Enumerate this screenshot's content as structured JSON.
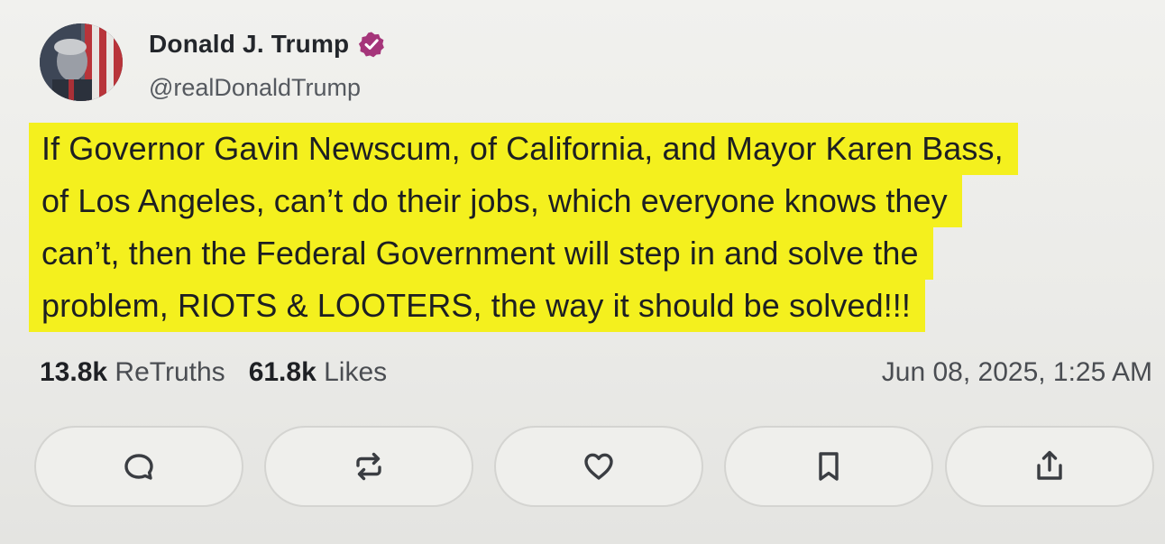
{
  "author": {
    "display_name": "Donald J. Trump",
    "handle": "@realDonaldTrump",
    "verified_icon": "verified-badge-icon",
    "verified_color": "#a5357a"
  },
  "post": {
    "lines": [
      "If Governor Gavin Newscum, of California, and Mayor Karen Bass,",
      "of Los Angeles, can’t do their jobs, which everyone knows they",
      "can’t, then the Federal Government will step in and solve the",
      "problem, RIOTS & LOOTERS, the way it should be solved!!!"
    ],
    "highlight_color": "#f4f01e"
  },
  "stats": {
    "retruths_count": "13.8k",
    "retruths_label": "ReTruths",
    "likes_count": "61.8k",
    "likes_label": "Likes"
  },
  "timestamp": "Jun 08, 2025, 1:25 AM",
  "actions": [
    {
      "icon": "reply-icon"
    },
    {
      "icon": "retruth-icon"
    },
    {
      "icon": "heart-icon"
    },
    {
      "icon": "bookmark-icon"
    },
    {
      "icon": "share-icon"
    }
  ]
}
